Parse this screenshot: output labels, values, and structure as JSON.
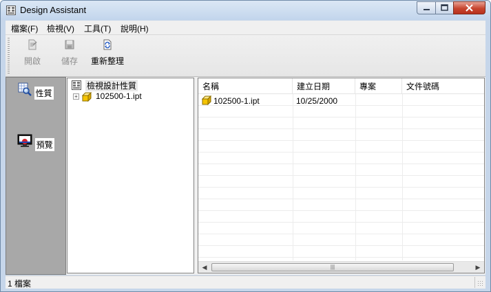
{
  "window": {
    "title": "Design Assistant"
  },
  "menu": [
    {
      "label": "檔案(F)"
    },
    {
      "label": "檢視(V)"
    },
    {
      "label": "工具(T)"
    },
    {
      "label": "說明(H)"
    }
  ],
  "toolbar": {
    "open_label": "開啟",
    "save_label": "儲存",
    "refresh_label": "重新整理"
  },
  "leftbar": {
    "properties_label": "性質",
    "preview_label": "預覽"
  },
  "tree": {
    "root_label": "檢視設計性質",
    "child_label": "102500-1.ipt"
  },
  "list": {
    "columns": [
      "名稱",
      "建立日期",
      "專案",
      "文件號碼"
    ],
    "rows": [
      {
        "name": "102500-1.ipt",
        "date": "10/25/2000",
        "project": "",
        "doc": ""
      }
    ]
  },
  "status": {
    "text": "1 檔案"
  },
  "colors": {
    "accent": "#c6d6ea",
    "close": "#c7452f",
    "leftbar": "#a8a8a8",
    "file_icon": "#f5c400"
  }
}
